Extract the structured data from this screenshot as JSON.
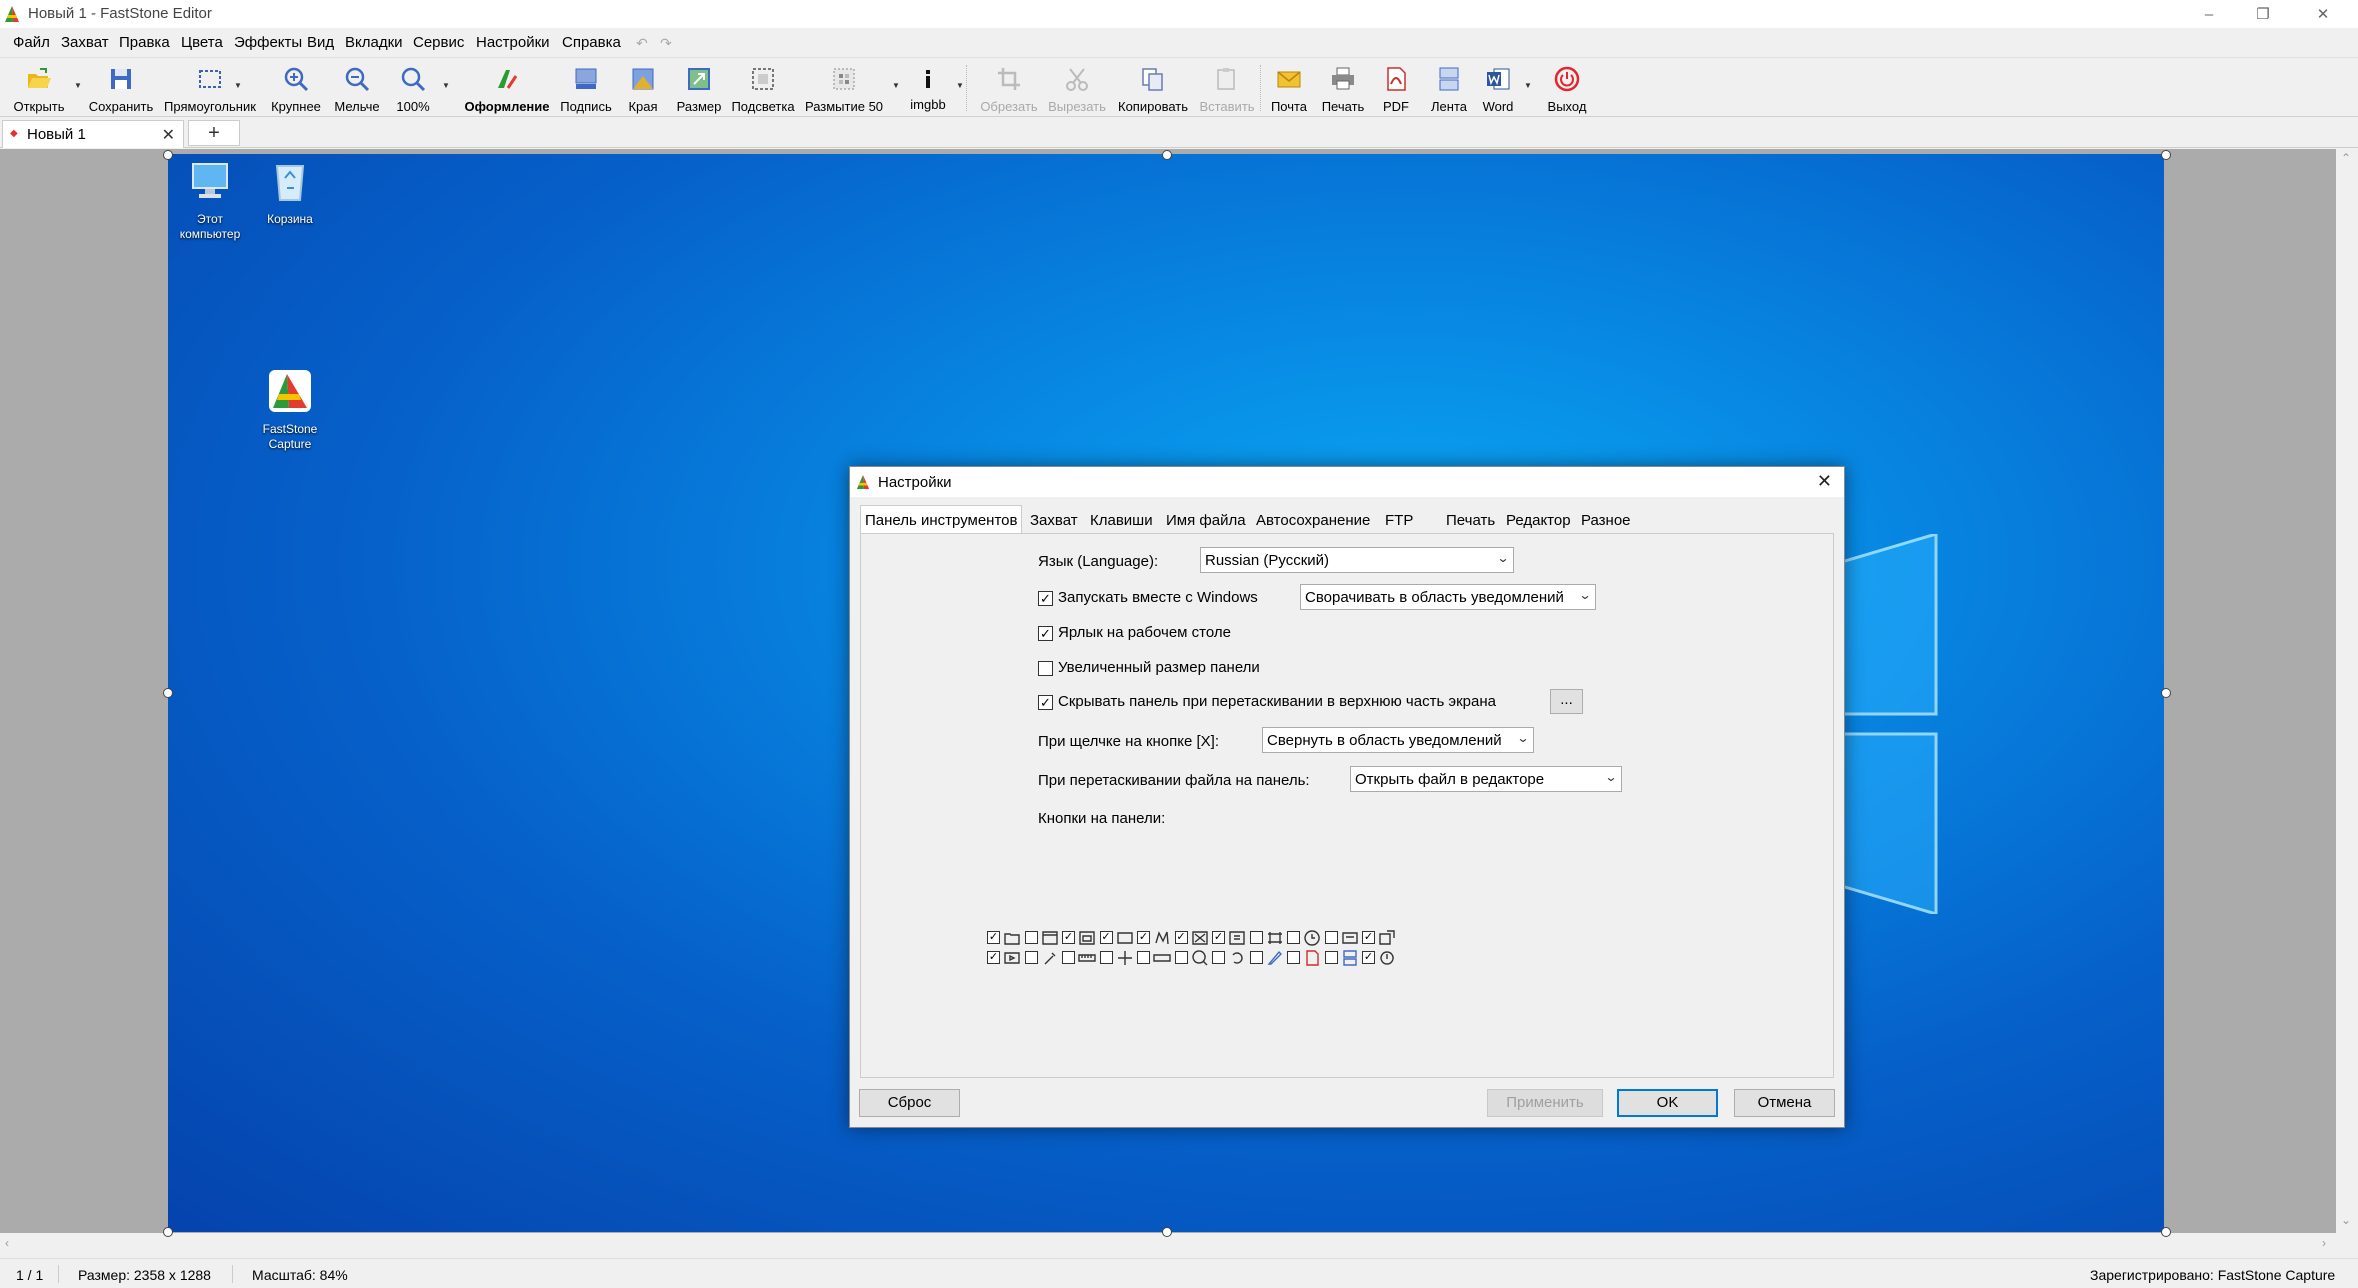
{
  "window": {
    "title": "Новый 1 - FastStone Editor"
  },
  "menu": [
    "Файл",
    "Захват",
    "Правка",
    "Цвета",
    "Эффекты",
    "Вид",
    "Вкладки",
    "Сервис",
    "Настройки",
    "Справка"
  ],
  "toolbar": {
    "open": "Открыть",
    "save": "Сохранить",
    "rect": "Прямоугольник",
    "zoom_in": "Крупнее",
    "zoom_out": "Мельче",
    "zoom_100": "100%",
    "decor": "Оформление",
    "caption": "Подпись",
    "edges": "Края",
    "resize": "Размер",
    "spotlight": "Подсветка",
    "blur": "Размытие 50",
    "imgbb": "imgbb",
    "crop": "Обрезать",
    "cut": "Вырезать",
    "copy": "Копировать",
    "paste": "Вставить",
    "mail": "Почта",
    "print": "Печать",
    "pdf": "PDF",
    "ribbon": "Лента",
    "word": "Word",
    "exit": "Выход"
  },
  "tabs": {
    "doc": "Новый 1",
    "new": "+"
  },
  "desktop": {
    "icons": [
      "Этот компьютер",
      "Корзина",
      "FastStone Capture"
    ]
  },
  "dialog": {
    "title": "Настройки",
    "tabs": [
      "Панель инструментов",
      "Захват",
      "Клавиши",
      "Имя файла",
      "Автосохранение",
      "FTP",
      "Печать",
      "Редактор",
      "Разное"
    ],
    "language_label": "Язык (Language):",
    "language_value": "Russian (Русский)",
    "startup_label": "Запускать вместе с Windows",
    "startup_checked": true,
    "startup_mode": "Сворачивать в область уведомлений",
    "shortcut_label": "Ярлык на рабочем столе",
    "shortcut_checked": true,
    "bigpanel_label": "Увеличенный размер панели",
    "bigpanel_checked": false,
    "hide_label": "Скрывать панель при перетаскивании в верхнюю часть экрана",
    "hide_checked": true,
    "more_btn": "...",
    "closex_label": "При щелчке на кнопке [X]:",
    "closex_value": "Свернуть в область уведомлений",
    "dragfile_label": "При перетаскивании файла на панель:",
    "dragfile_value": "Открыть файл в редакторе",
    "buttons_label": "Кнопки на панели:",
    "panel_buttons_row1": [
      {
        "checked": true,
        "icon": "folder-open-icon"
      },
      {
        "checked": false,
        "icon": "window-icon"
      },
      {
        "checked": true,
        "icon": "object-icon"
      },
      {
        "checked": true,
        "icon": "rectangle-select-icon"
      },
      {
        "checked": true,
        "icon": "freehand-icon"
      },
      {
        "checked": true,
        "icon": "fullscreen-icon"
      },
      {
        "checked": true,
        "icon": "scrolling-window-icon"
      },
      {
        "checked": false,
        "icon": "fixed-region-icon"
      },
      {
        "checked": false,
        "icon": "delayed-capture-icon"
      },
      {
        "checked": false,
        "icon": "output-icon"
      },
      {
        "checked": true,
        "icon": "export-icon"
      }
    ],
    "panel_buttons_row2": [
      {
        "checked": true,
        "icon": "video-record-icon"
      },
      {
        "checked": false,
        "icon": "color-picker-icon"
      },
      {
        "checked": false,
        "icon": "screen-ruler-icon"
      },
      {
        "checked": false,
        "icon": "crosshair-icon"
      },
      {
        "checked": false,
        "icon": "screen-recorder-icon"
      },
      {
        "checked": false,
        "icon": "magnifier-icon"
      },
      {
        "checked": false,
        "icon": "undo-capture-icon"
      },
      {
        "checked": false,
        "icon": "editor-icon"
      },
      {
        "checked": false,
        "icon": "pdf-icon"
      },
      {
        "checked": false,
        "icon": "combine-icon"
      },
      {
        "checked": true,
        "icon": "timer-icon"
      }
    ],
    "reset": "Сброс",
    "apply": "Применить",
    "ok": "OK",
    "cancel": "Отмена"
  },
  "status": {
    "page": "1 / 1",
    "size": "Размер: 2358 x 1288",
    "zoom": "Масштаб: 84%",
    "registered": "Зарегистрировано: FastStone Capture"
  },
  "colors": {
    "accent": "#0078d7",
    "desktop": "#0660c9",
    "exit_icon": "#e0262e"
  }
}
